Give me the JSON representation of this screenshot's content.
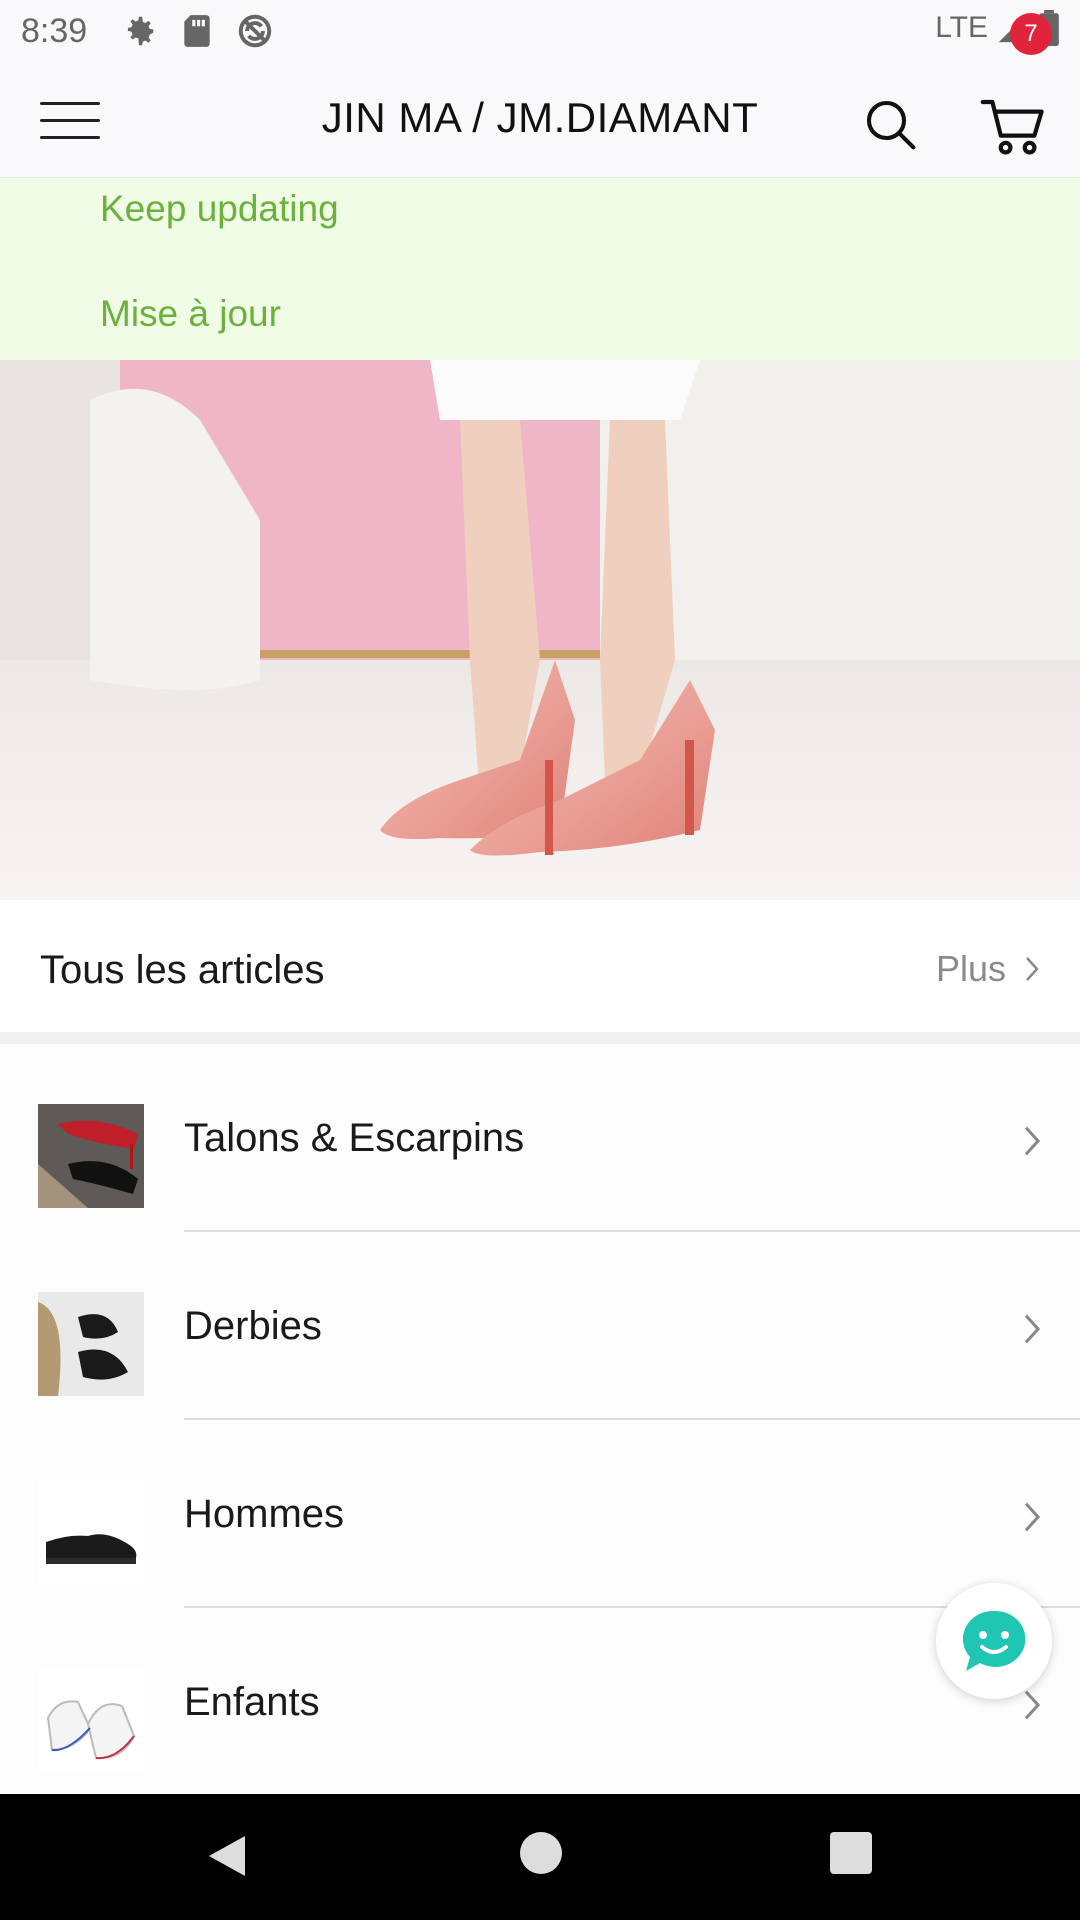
{
  "status_bar": {
    "time": "8:39",
    "network": "LTE",
    "icons": [
      "gear-icon",
      "sd-card-icon",
      "sync-icon",
      "signal-icon",
      "battery-icon"
    ]
  },
  "header": {
    "title": "JIN MA / JM.DIAMANT",
    "cart_count": "7",
    "icons": [
      "menu-icon",
      "search-icon",
      "cart-icon"
    ]
  },
  "notice": {
    "lines": [
      "Keep updating",
      "Mise à jour"
    ],
    "color": "#6ab23b",
    "background": "#f1fce6"
  },
  "section": {
    "title": "Tous les articles",
    "more_label": "Plus"
  },
  "categories": [
    {
      "label": "Talons & Escarpins",
      "thumb": "heels-thumbnail"
    },
    {
      "label": "Derbies",
      "thumb": "derbies-thumbnail"
    },
    {
      "label": "Hommes",
      "thumb": "men-sneaker-thumbnail"
    },
    {
      "label": "Enfants",
      "thumb": "kids-sneaker-thumbnail"
    }
  ],
  "colors": {
    "badge": "#e2233c",
    "chat_accent": "#1fc6b4"
  }
}
